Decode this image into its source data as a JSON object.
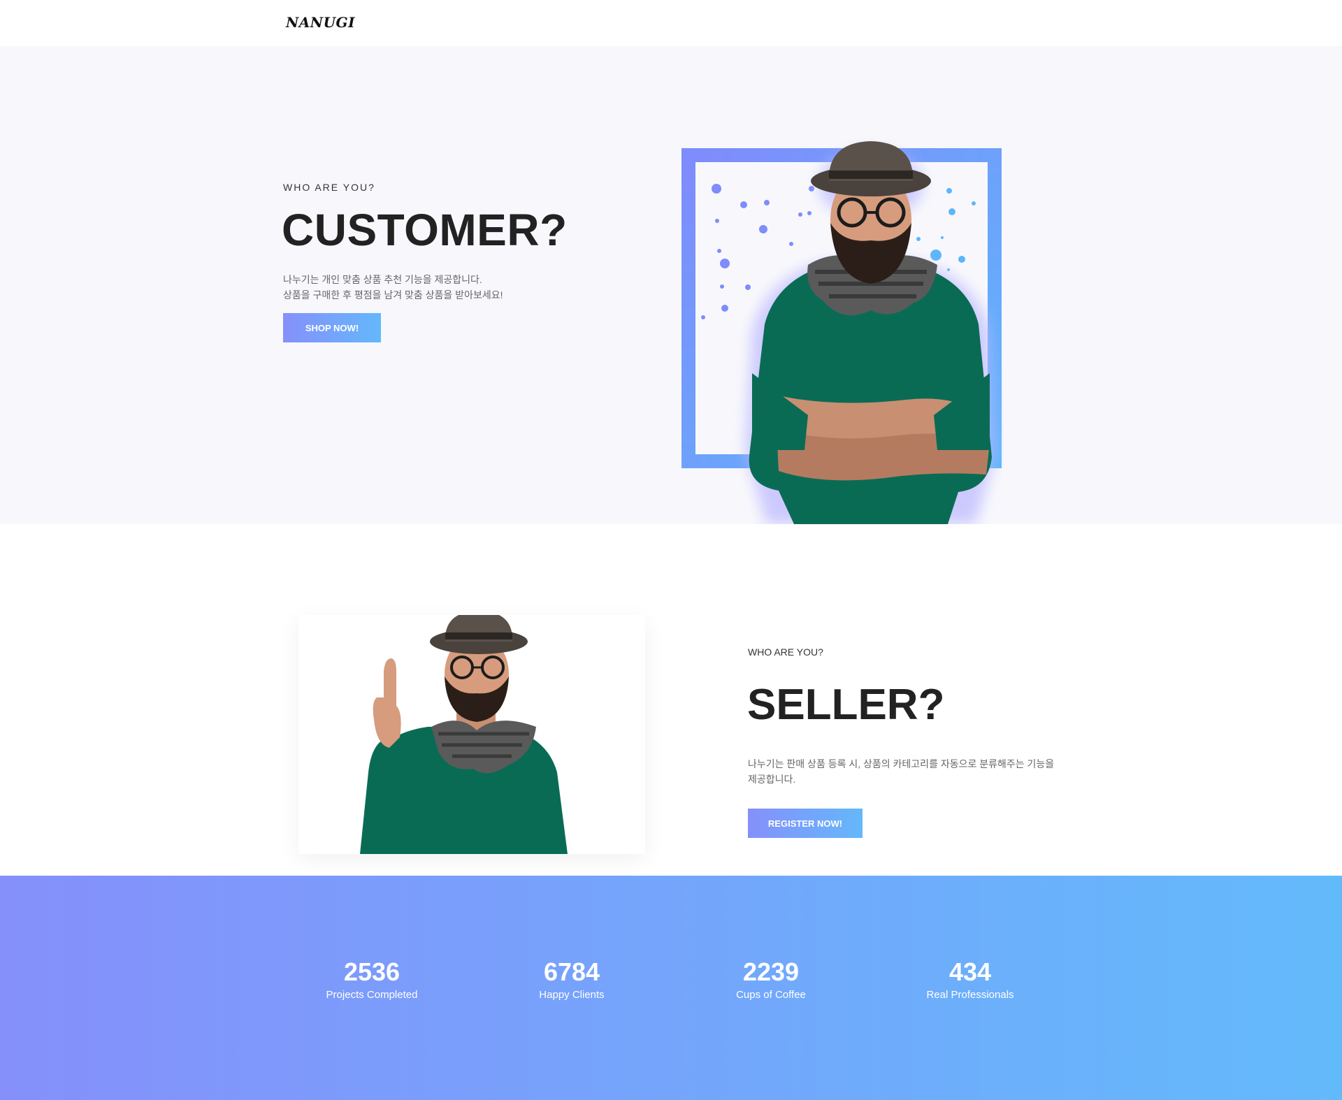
{
  "header": {
    "logo": "NANUGI"
  },
  "customer": {
    "eyebrow": "WHO ARE YOU?",
    "title": "CUSTOMER?",
    "desc_line1": "나누기는 개인 맞춤 상품 추천 기능을 제공합니다.",
    "desc_line2": "상품을 구매한 후 평점을 남겨 맞춤 상품을 받아보세요!",
    "button_label": "SHOP NOW!",
    "image": "man-with-crossed-arms-photo"
  },
  "seller": {
    "eyebrow": "WHO ARE YOU?",
    "title": "SELLER?",
    "desc": "나누기는 판매 상품 등록 시, 상품의 카테고리를 자동으로 분류해주는 기능을 제공합니다.",
    "button_label": "REGISTER NOW!",
    "image": "man-pointing-up-photo"
  },
  "stats": [
    {
      "value": "2536",
      "label": "Projects Completed"
    },
    {
      "value": "6784",
      "label": "Happy Clients"
    },
    {
      "value": "2239",
      "label": "Cups of Coffee"
    },
    {
      "value": "434",
      "label": "Real Professionals"
    }
  ],
  "colors": {
    "gradient_start": "#8590fb",
    "gradient_end": "#63bafb",
    "hero_bg": "#f8f8fc",
    "sweater": "#0a6b55"
  }
}
